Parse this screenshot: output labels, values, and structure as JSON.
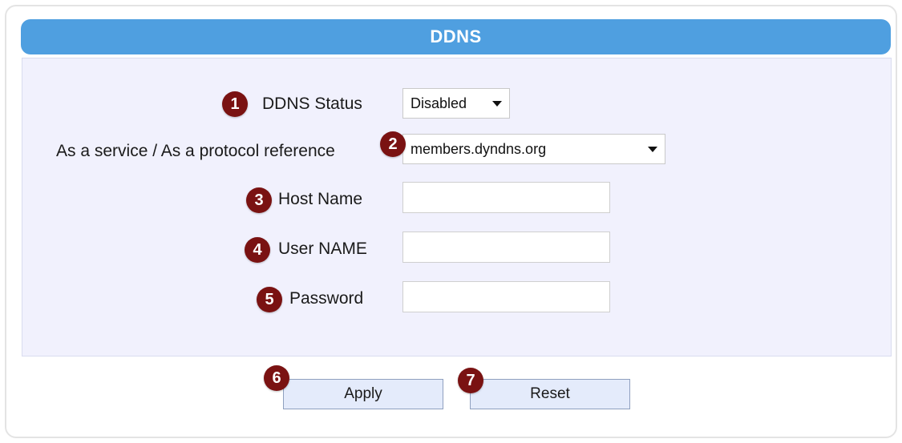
{
  "header": {
    "title": "DDNS"
  },
  "fields": {
    "ddns_status": {
      "badge": "1",
      "label": "DDNS Status",
      "value": "Disabled"
    },
    "service": {
      "badge": "2",
      "label": "As a service / As a protocol reference",
      "value": "members.dyndns.org"
    },
    "host_name": {
      "badge": "3",
      "label": "Host Name",
      "value": ""
    },
    "user_name": {
      "badge": "4",
      "label": "User NAME",
      "value": ""
    },
    "password": {
      "badge": "5",
      "label": "Password",
      "value": ""
    }
  },
  "buttons": {
    "apply": {
      "badge": "6",
      "label": "Apply"
    },
    "reset": {
      "badge": "7",
      "label": "Reset"
    }
  },
  "icons": {
    "badge": "numbered-circle-badge",
    "dropdown": "triangle-down-icon"
  },
  "colors": {
    "header": "#4f9fe0",
    "panel": "#f1f1fd",
    "badge": "#7a1212",
    "button": "#e4ebfb"
  }
}
